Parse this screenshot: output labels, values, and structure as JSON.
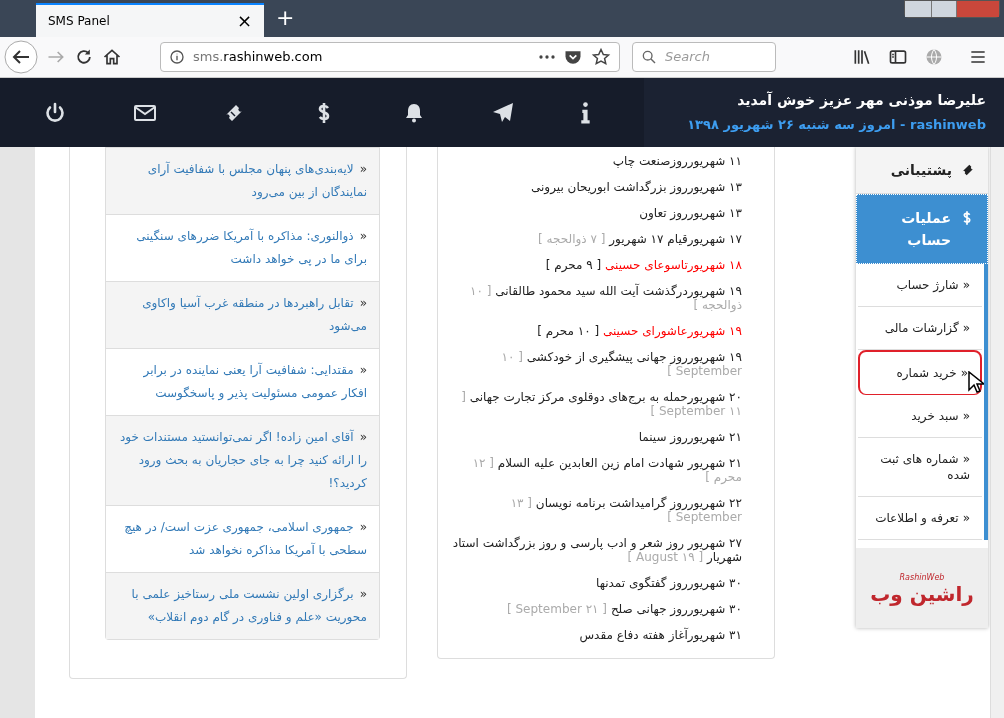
{
  "browser": {
    "tab_title": "SMS Panel",
    "tab_close": "×",
    "new_tab": "+",
    "url_host": "sms.",
    "url_domain": "rashinweb.com",
    "search_placeholder": "Search"
  },
  "header": {
    "welcome": "علیرضا موذنی مهر عزیز خوش آمدید",
    "date_line": "rashinweb - امروز سه شنبه ۲۶ شهریور ۱۳۹۸",
    "icons": [
      {
        "kind": "power"
      },
      {
        "kind": "mail"
      },
      {
        "kind": "ticket"
      },
      {
        "kind": "dollar"
      },
      {
        "kind": "bell"
      },
      {
        "kind": "plane"
      },
      {
        "kind": "info"
      }
    ]
  },
  "bullet": "«",
  "news": [
    {
      "text": "لایه‌بندی‌های پنهان مجلس با شفافیت آرای نمایندگان از بین می‌رود"
    },
    {
      "text": "ذوالنوری: مذاکره با آمریکا ضررهای سنگینی برای ما در پی خواهد داشت"
    },
    {
      "text": "تقابل راهبردها در منطقه غرب آسیا واکاوی می‌شود"
    },
    {
      "text": "مقتدایی: شفافیت آرا یعنی نماینده در برابر افکار عمومی مسئولیت پذیر و پاسخگوست"
    },
    {
      "text": "آقای امین زاده! اگر نمی‌توانستید مستندات خود را ارائه کنید چرا به جای حجاریان به بحث ورود کردید؟!"
    },
    {
      "text": "جمهوری اسلامی، جمهوری عزت است/ در هیچ سطحی با آمریکا مذاکره نخواهد شد"
    },
    {
      "text": "برگزاری اولین نشست ملی رستاخیز علمی با محوریت «علم و فناوری در گام دوم انقلاب»"
    }
  ],
  "events": [
    {
      "text": "۱۱ شهریورروزصنعت چاپ",
      "holiday": false
    },
    {
      "text": "۱۳ شهریورروز بزرگداشت ابوریحان بیرونی",
      "holiday": false
    },
    {
      "text": "۱۳ شهریورروز تعاون",
      "holiday": false
    },
    {
      "text": "۱۷ شهریورقیام ۱۷ شهریور",
      "note": "[ ۷ ذوالحجه ]",
      "holiday": false
    },
    {
      "text": "۱۸ شهریورتاسوعای حسینی",
      "note": "[ ۹ محرم ]",
      "holiday": true
    },
    {
      "text": "۱۹ شهریوردرگذشت آیت الله سید محمود طالقانی",
      "note": "[ ۱۰ ذوالحجه ]",
      "holiday": false
    },
    {
      "text": "۱۹ شهریورعاشورای حسینی",
      "note": "[ ۱۰ محرم ]",
      "holiday": true
    },
    {
      "text": "۱۹ شهریورروز جهانی پیشگیری از خودکشی",
      "note": "[ ۱۰ September ]",
      "holiday": false
    },
    {
      "text": "۲۰ شهریورحمله به برج‌های دوقلوی مرکز تجارت جهانی",
      "note": "[ ۱۱ September ]",
      "holiday": false
    },
    {
      "text": "۲۱ شهریورروز سینما",
      "holiday": false
    },
    {
      "text": "۲۱ شهریور شهادت امام زین العابدین علیه السلام",
      "note": "[ ۱۲ محرم ]",
      "holiday": false
    },
    {
      "text": "۲۲ شهریورروز گرامیداشت برنامه نویسان",
      "note": "[ ۱۳ September ]",
      "holiday": false
    },
    {
      "text": "۲۷ شهریور روز شعر و ادب پارسی و روز بزرگداشت استاد شهریار",
      "note": "[ ۱۹ August ]",
      "holiday": false
    },
    {
      "text": "۳۰ شهریورروز گفتگوی تمدنها",
      "holiday": false
    },
    {
      "text": "۳۰ شهریورروز جهانی صلح",
      "note": "[ ۲۱ September ]",
      "holiday": false
    },
    {
      "text": "۳۱ شهریورآغاز هفته دفاع مقدس",
      "holiday": false
    }
  ],
  "sidebar": {
    "items": [
      {
        "label": "پشتیبانی",
        "kind": "ticket",
        "selected": false
      },
      {
        "label": "عملیات حساب",
        "kind": "dollar",
        "selected": true
      }
    ],
    "submenu": [
      {
        "label": "شارژ حساب",
        "highlighted": false
      },
      {
        "label": "گزارشات مالی",
        "highlighted": false
      },
      {
        "label": "خرید شماره",
        "highlighted": true
      },
      {
        "label": "سبد خرید",
        "highlighted": false
      },
      {
        "label": "شماره های ثبت شده",
        "highlighted": false
      },
      {
        "label": "تعرفه و اطلاعات",
        "highlighted": false
      }
    ],
    "logo": {
      "latin": "RashinWeb",
      "persian": "راشین وب"
    }
  }
}
